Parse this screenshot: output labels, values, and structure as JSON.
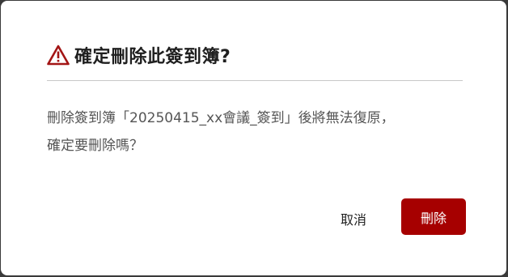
{
  "dialog": {
    "title": "確定刪除此簽到簿?",
    "icon": "warning-triangle-icon",
    "message_line1": "刪除簽到簿「20250415_xx會議_簽到」後將無法復原，",
    "message_line2": "確定要刪除嗎？",
    "cancel_label": "取消",
    "delete_label": "刪除"
  },
  "colors": {
    "accent": "#a60000",
    "warning_icon": "#a31515",
    "title_text": "#1f1f1f",
    "body_text": "#555555"
  }
}
